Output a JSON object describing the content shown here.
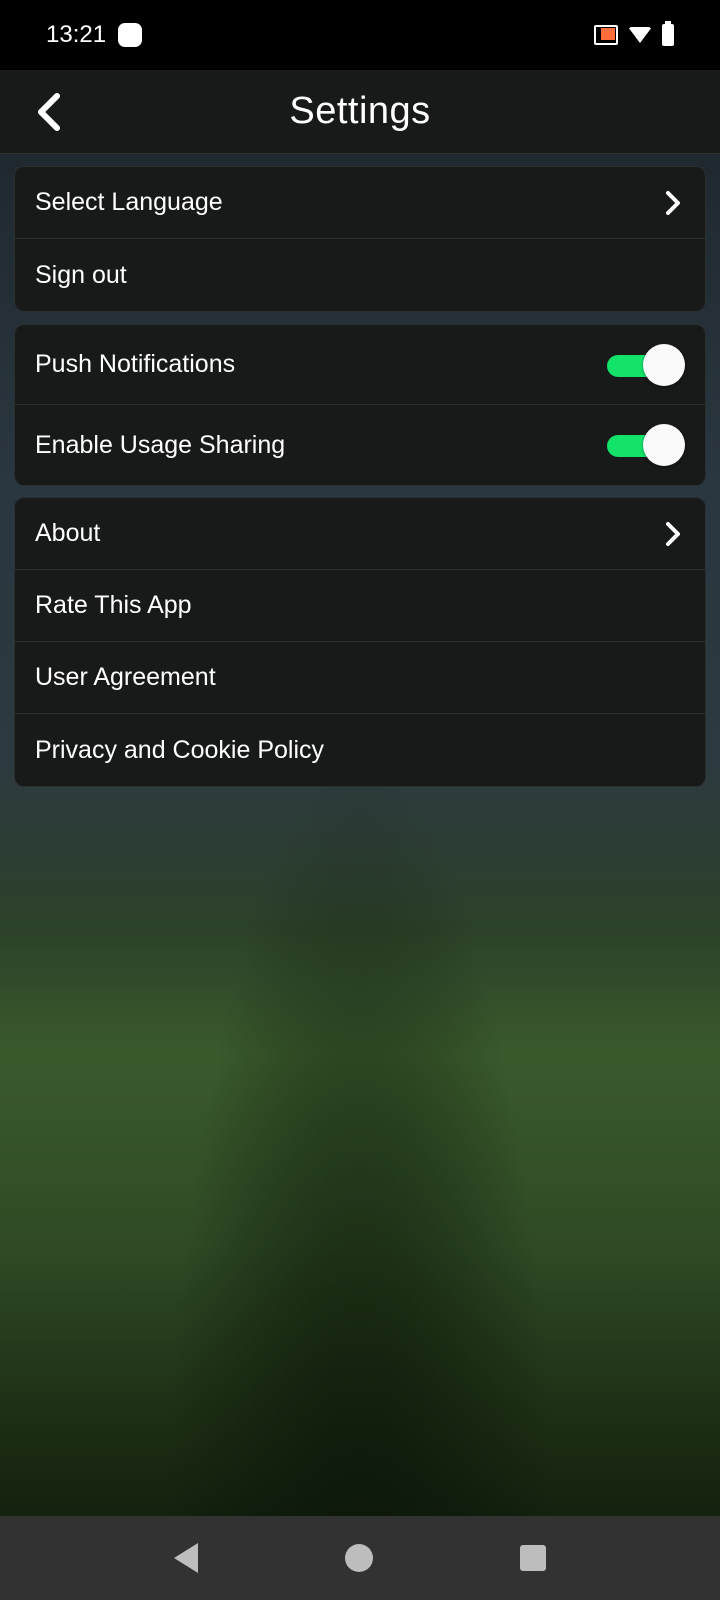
{
  "status_bar": {
    "time": "13:21",
    "icons": [
      "notification-dot-icon",
      "cast-icon",
      "wifi-icon",
      "battery-icon"
    ]
  },
  "app_bar": {
    "title": "Settings",
    "back_icon": "chevron-left-icon"
  },
  "groups": [
    {
      "items": [
        {
          "label": "Select Language",
          "type": "link",
          "icon": "chevron-right-icon"
        },
        {
          "label": "Sign out",
          "type": "action"
        }
      ]
    },
    {
      "items": [
        {
          "label": "Push Notifications",
          "type": "toggle",
          "enabled": true
        },
        {
          "label": "Enable Usage Sharing",
          "type": "toggle",
          "enabled": true
        }
      ]
    },
    {
      "items": [
        {
          "label": "About",
          "type": "link",
          "icon": "chevron-right-icon"
        },
        {
          "label": "Rate This App",
          "type": "action"
        },
        {
          "label": "User Agreement",
          "type": "action"
        },
        {
          "label": "Privacy and Cookie Policy",
          "type": "action"
        }
      ]
    }
  ],
  "colors": {
    "toggle_on": "#14e36a",
    "card_bg": "#181a1a"
  },
  "nav_bar": {
    "icons": [
      "nav-back-icon",
      "nav-home-icon",
      "nav-recents-icon"
    ]
  }
}
